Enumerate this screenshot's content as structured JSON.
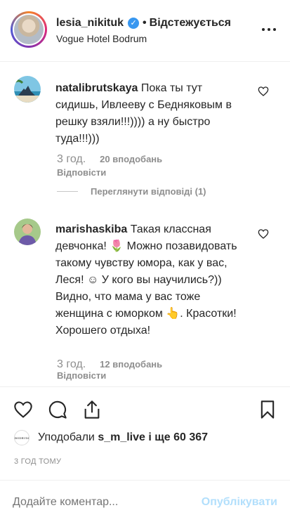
{
  "header": {
    "username": "lesia_nikituk",
    "separator": "•",
    "follow_status": "Відстежується",
    "location": "Vogue Hotel Bodrum"
  },
  "comments": [
    {
      "username": "natalibrutskaya",
      "text": "Пока ты тут сидишь, Ивлееву с Бедняковым в решку взяли!!!)))) а ну быстро туда!!!)))",
      "time": "3 год.",
      "likes": "20 вподобань",
      "reply": "Відповісти",
      "view_replies": "Переглянути відповіді (1)"
    },
    {
      "username": "marishaskiba",
      "text": "Такая классная девчонка! 🌷 Можно позавидовать такому чувству юмора, как у вас, Леся! ☺ У кого вы научились?)) Видно, что мама у вас тоже женщина с юморком 👆. Красотки! Хорошего отдыха!",
      "time": "3 год.",
      "likes": "12 вподобань",
      "reply": "Відповісти"
    }
  ],
  "likes": {
    "avatar_label": "BODRUM",
    "prefix": "Уподобали",
    "user": "s_m_live",
    "suffix": "і ще 60 367"
  },
  "post_time": "3 ГОД ТОМУ",
  "add_comment": {
    "placeholder": "Додайте коментар...",
    "publish": "Опублікувати"
  },
  "icons": {
    "verified": "verified-badge-icon",
    "more": "more-options-icon",
    "like": "heart-icon",
    "comment": "comment-bubble-icon",
    "share": "share-icon",
    "save": "bookmark-icon"
  },
  "colors": {
    "verified": "#3897f0",
    "muted": "#8e8e8e",
    "publish_disabled": "#b2dffc"
  }
}
